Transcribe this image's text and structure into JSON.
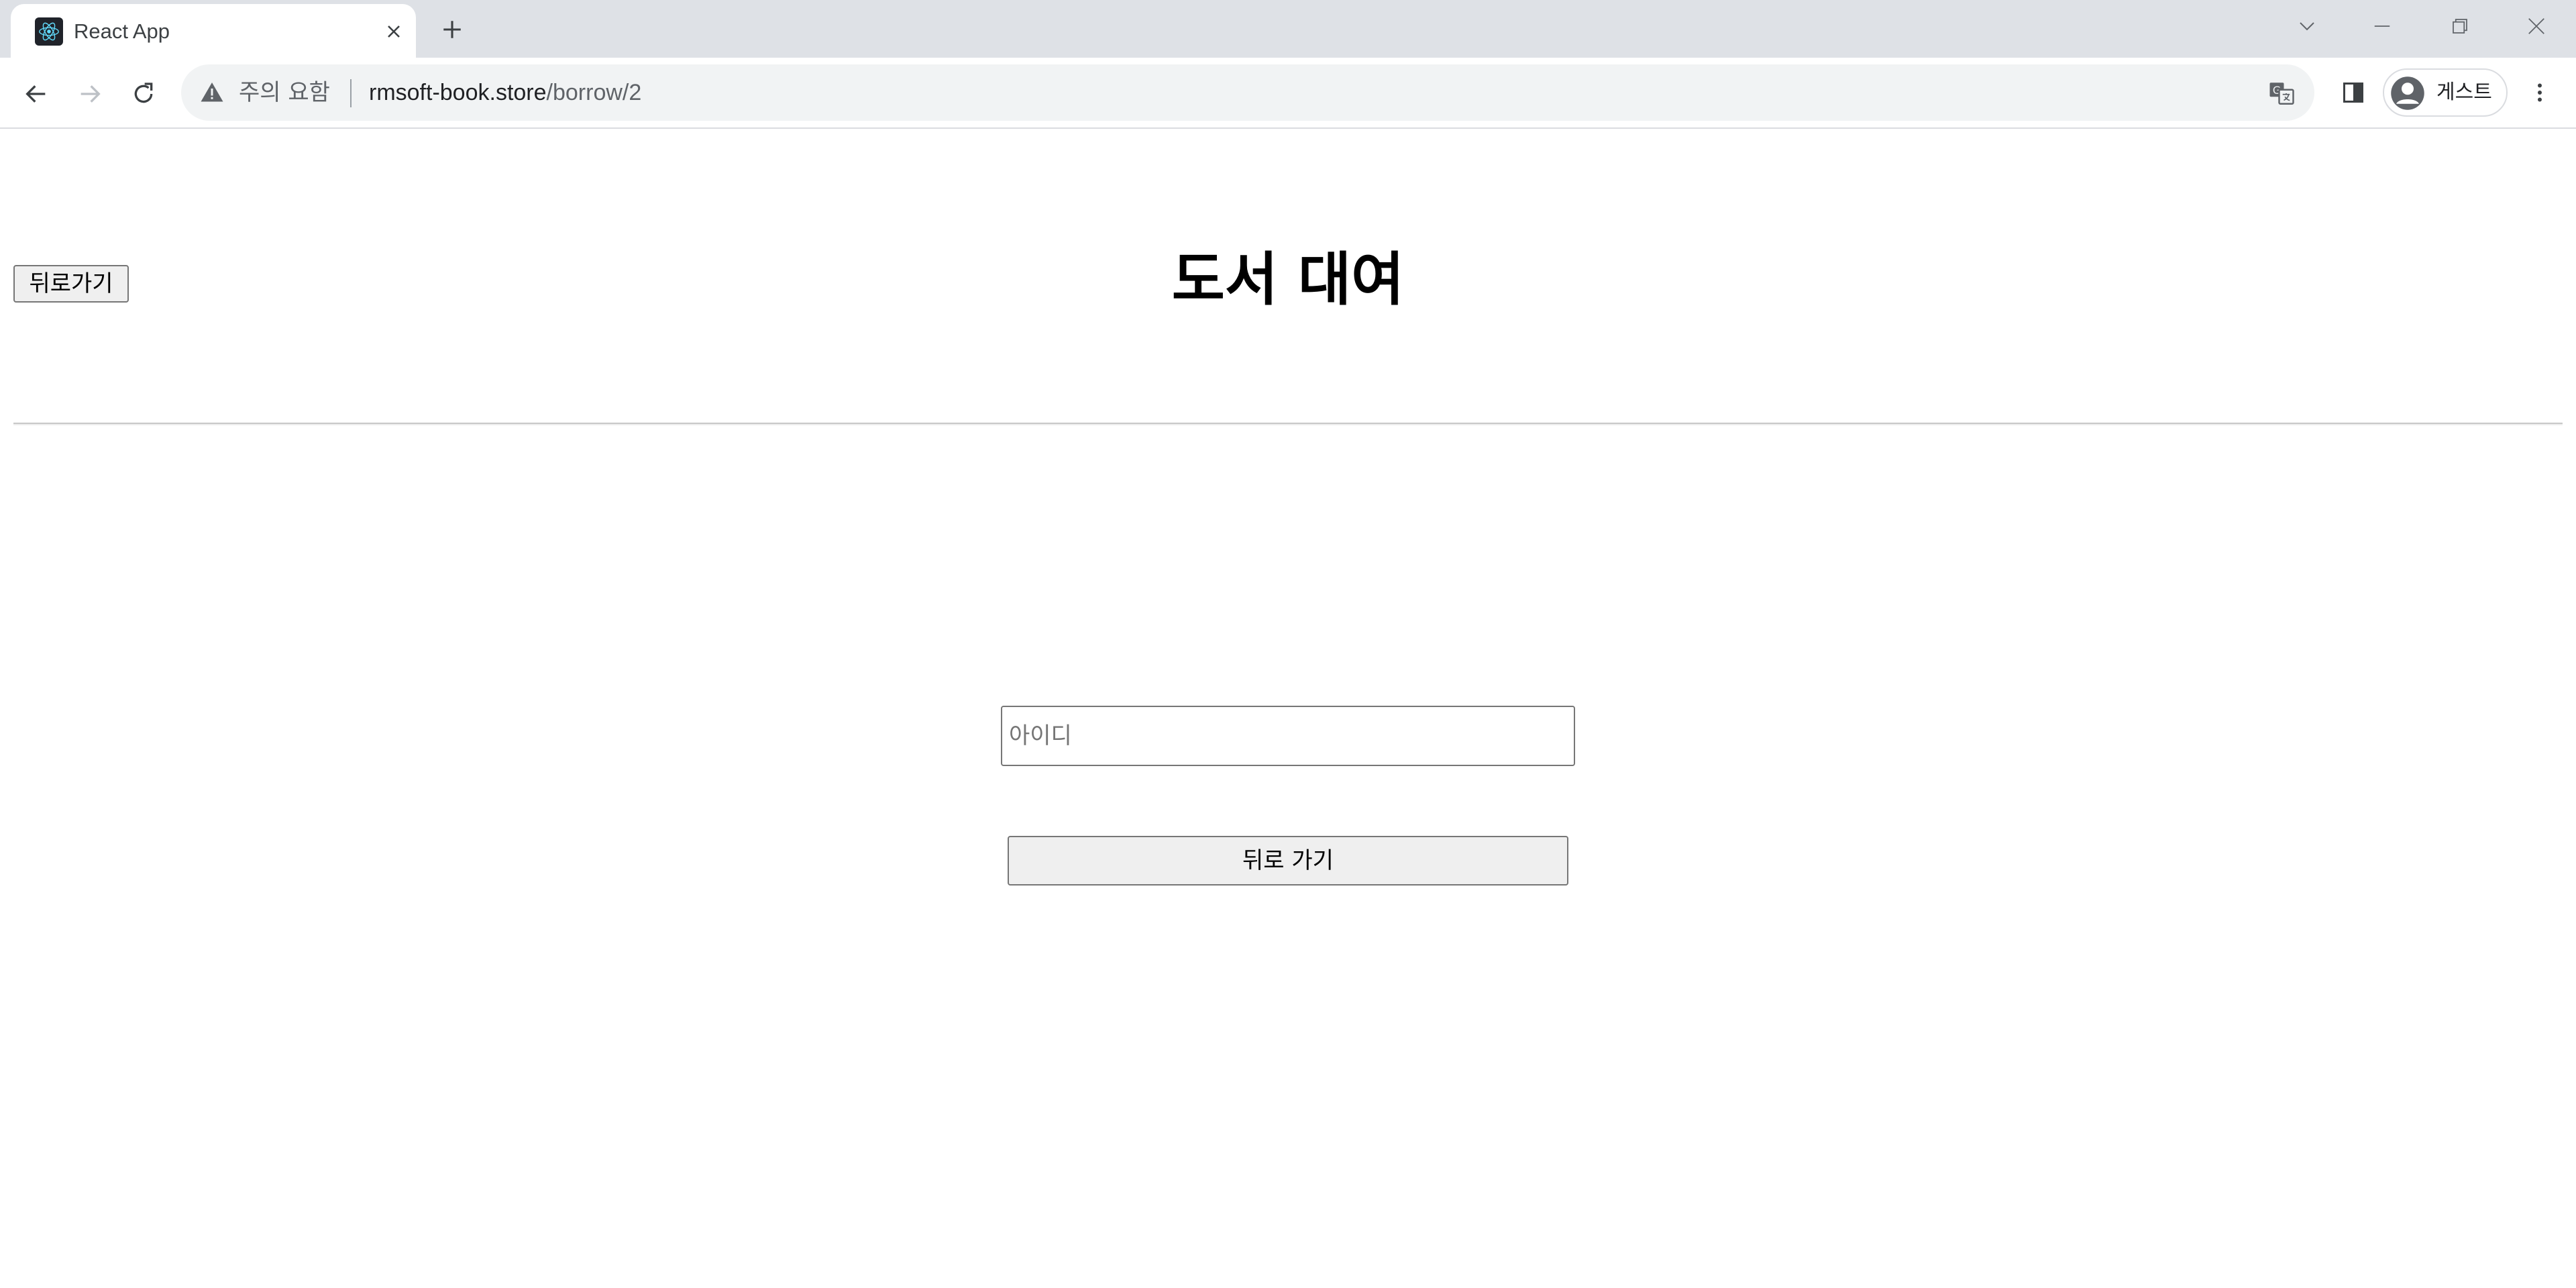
{
  "browser": {
    "tab": {
      "title": "React App",
      "favicon": "react-logo-icon"
    },
    "omnibox": {
      "security_label": "주의 요함",
      "url_host": "rmsoft-book.store",
      "url_path": "/borrow/2"
    },
    "profile": {
      "label": "게스트"
    },
    "colors": {
      "tabstrip": "#dee1e6",
      "omnibox": "#f1f3f4",
      "react_cyan": "#61dafb"
    }
  },
  "page": {
    "header_back_label": "뒤로가기",
    "title": "도서 대여",
    "id_input": {
      "placeholder": "아이디",
      "value": ""
    },
    "back_button_label": "뒤로 가기"
  }
}
